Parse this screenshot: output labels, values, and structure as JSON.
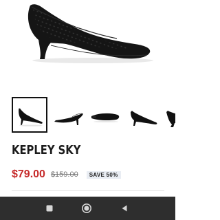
{
  "product": {
    "name": "KEPLEY SKY",
    "price": "$79.00",
    "original_price": "$159.00",
    "discount_badge": "SAVE 50%"
  },
  "gallery": {
    "selected_index": 0,
    "thumbnails": [
      {
        "view": "side-view"
      },
      {
        "view": "angled-view"
      },
      {
        "view": "sole-view"
      },
      {
        "view": "side-view"
      },
      {
        "view": "rear-view"
      }
    ]
  },
  "colors": {
    "price": "#c62a2a",
    "shoe": "#111111",
    "badge_bg": "#e9edf3",
    "navbar": "#2e2e2e"
  },
  "system_nav": {
    "icons": [
      "recent-apps-icon",
      "home-icon",
      "back-icon"
    ]
  }
}
